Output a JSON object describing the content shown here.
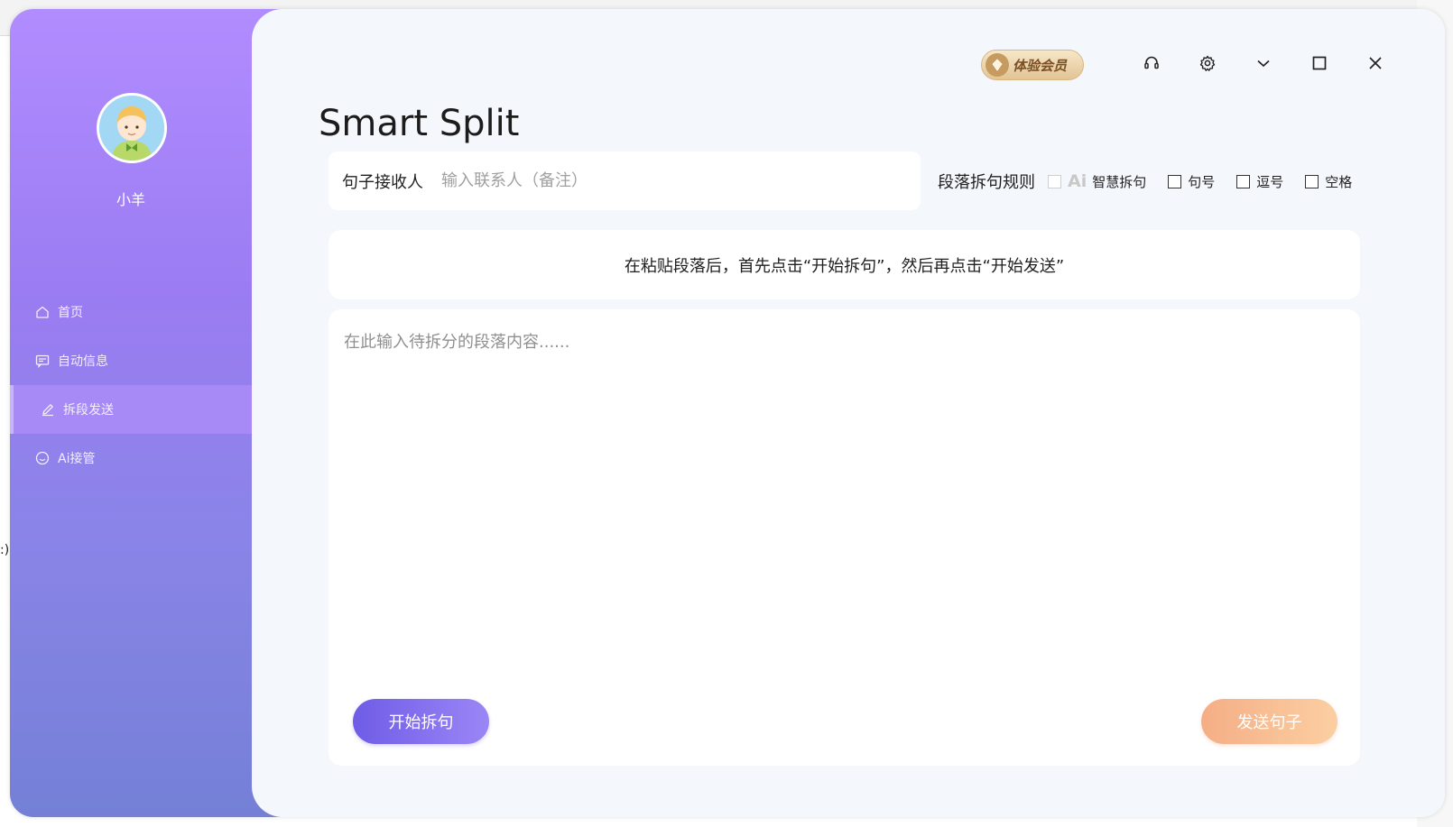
{
  "user": {
    "name": "小羊"
  },
  "sidebar": {
    "items": [
      {
        "label": "首页",
        "icon": "home-icon",
        "active": false
      },
      {
        "label": "自动信息",
        "icon": "message-icon",
        "active": false
      },
      {
        "label": "拆段发送",
        "icon": "edit-icon",
        "active": true
      },
      {
        "label": "Ai接管",
        "icon": "smile-icon",
        "active": false
      }
    ]
  },
  "topbar": {
    "vip_label": "体验会员",
    "icons": [
      "headset-icon",
      "gear-icon",
      "chevron-down-icon",
      "maximize-icon",
      "close-icon"
    ]
  },
  "page": {
    "title": "Smart Split"
  },
  "recipient": {
    "label": "句子接收人",
    "placeholder": "输入联系人（备注）",
    "value": ""
  },
  "rules": {
    "label": "段落拆句规则",
    "ai_mark": "Ai",
    "options": [
      {
        "label": "智慧拆句",
        "checked": false
      },
      {
        "label": "句号",
        "checked": false
      },
      {
        "label": "逗号",
        "checked": false
      },
      {
        "label": "空格",
        "checked": false
      }
    ]
  },
  "hint": {
    "text": "在粘贴段落后，首先点击“开始拆句”，然后再点击“开始发送”"
  },
  "content": {
    "placeholder": "在此输入待拆分的段落内容......",
    "value": ""
  },
  "actions": {
    "start_label": "开始拆句",
    "send_label": "发送句子"
  },
  "background": {
    "edge_text": ":)"
  },
  "colors": {
    "sidebar_top": "#b18cff",
    "sidebar_bottom": "#7480d6",
    "start_button": "#7f6cec",
    "send_button": "#f7bb93",
    "vip_gold": "#e2c496"
  }
}
